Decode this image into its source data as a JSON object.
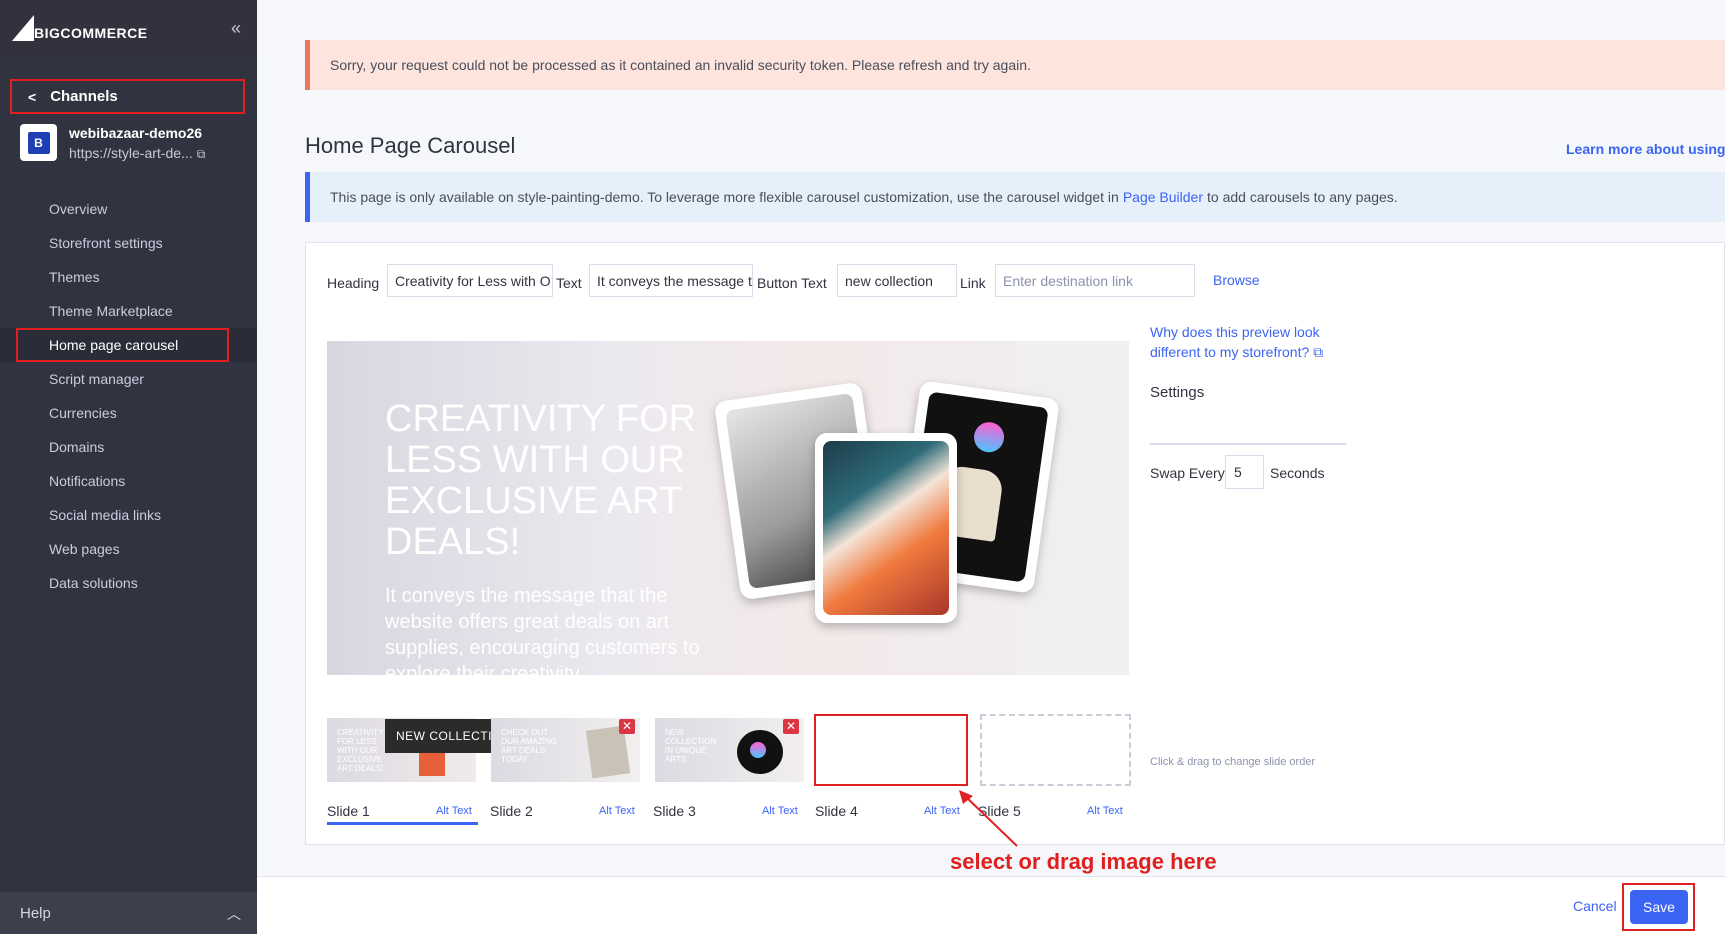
{
  "sidebar": {
    "logo_text": "BIGCOMMERCE",
    "channels_label": "Channels",
    "store_name": "webibazaar-demo26",
    "store_url": "https://style-art-de...",
    "nav_items": [
      "Overview",
      "Storefront settings",
      "Themes",
      "Theme Marketplace",
      "Home page carousel",
      "Script manager",
      "Currencies",
      "Domains",
      "Notifications",
      "Social media links",
      "Web pages",
      "Data solutions"
    ],
    "active_item": "Home page carousel",
    "help_label": "Help"
  },
  "main": {
    "error_alert": "Sorry, your request could not be processed as it contained an invalid security token. Please refresh and try again.",
    "title": "Home Page Carousel",
    "learn_more": "Learn more about using t",
    "info_prefix": "This page is only available on style-painting-demo. To leverage more flexible carousel customization, use the carousel widget in",
    "info_link": "Page Builder",
    "info_suffix": "to add carousels to any pages."
  },
  "form": {
    "heading_label": "Heading",
    "heading_value": "Creativity for Less with O",
    "text_label": "Text",
    "text_value": "It conveys the message th",
    "button_text_label": "Button Text",
    "button_text_value": "new collection",
    "link_label": "Link",
    "link_placeholder": "Enter destination link",
    "browse_label": "Browse"
  },
  "preview": {
    "heading": "CREATIVITY FOR LESS WITH OUR EXCLUSIVE ART DEALS!",
    "text": "It conveys the message that the website offers great deals on art supplies, encouraging customers to explore their creativity"
  },
  "side": {
    "why_link": "Why does this preview look different to my storefront?",
    "settings_label": "Settings",
    "swap_label": "Swap Every",
    "swap_value": "5",
    "seconds_label": "Seconds",
    "drag_note": "Click & drag to change slide order"
  },
  "slides": {
    "newcol_label": "NEW COLLECTION",
    "thumb1_text": "CREATIVITY FOR LESS WITH OUR EXCLUSIVE ART DEALS!",
    "thumb2_text": "CHECK OUT OUR AMAZING ART DEALS TODAY",
    "thumb3_text": "NEW COLLECTION IN UNIQUE ARTS",
    "labels": [
      "Slide 1",
      "Slide 2",
      "Slide 3",
      "Slide 4",
      "Slide 5"
    ],
    "alt_text": "Alt Text",
    "delete_glyph": "✕"
  },
  "annotation": "select or drag image here",
  "footer": {
    "cancel_label": "Cancel",
    "save_label": "Save"
  },
  "colors": {
    "accent": "#3c64f4",
    "highlight_red": "#e02020",
    "sidebar_bg": "#313440"
  }
}
